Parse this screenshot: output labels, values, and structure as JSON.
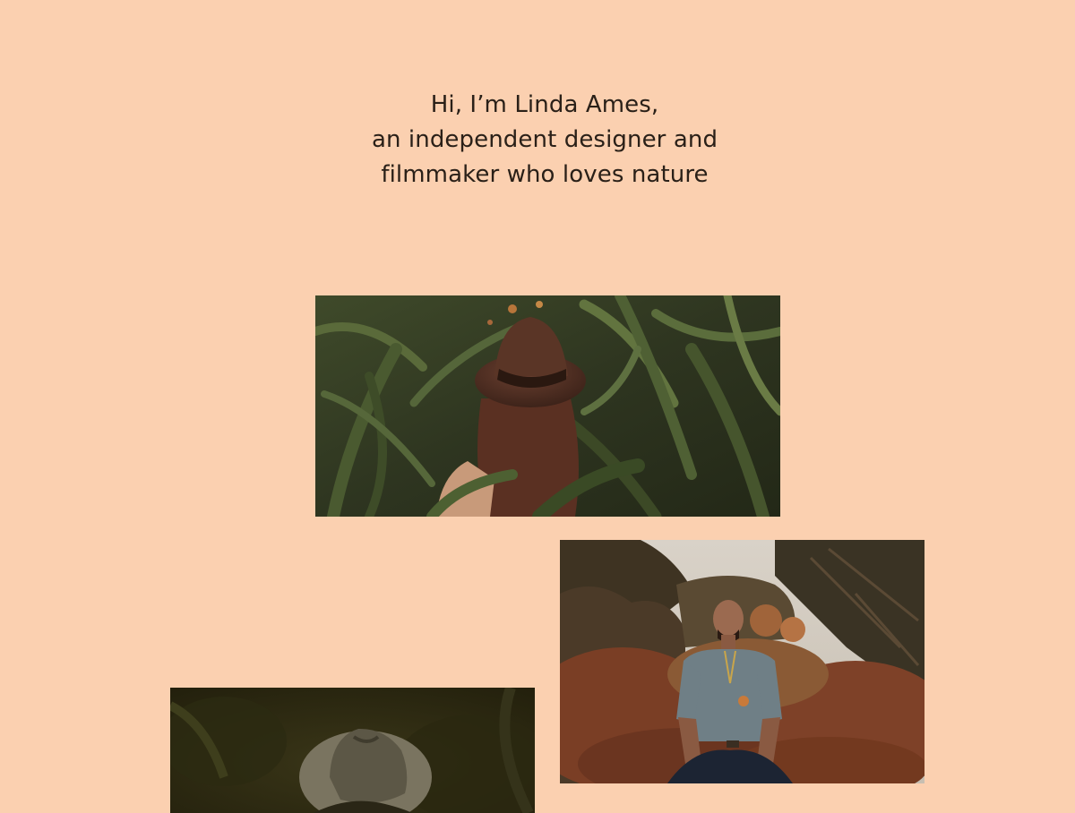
{
  "intro": {
    "line1": "Hi, I’m Linda Ames,",
    "line2": "an independent designer and",
    "line3": "filmmaker who loves nature"
  },
  "gallery": {
    "photos": [
      {
        "subject": "woman-in-brown-hat-in-cornfield"
      },
      {
        "subject": "man-crouching-in-autumn-bushes"
      },
      {
        "subject": "person-in-grey-hat-dark-foliage"
      }
    ]
  },
  "colors": {
    "background": "#fbd0b0",
    "text": "#2a2018"
  }
}
